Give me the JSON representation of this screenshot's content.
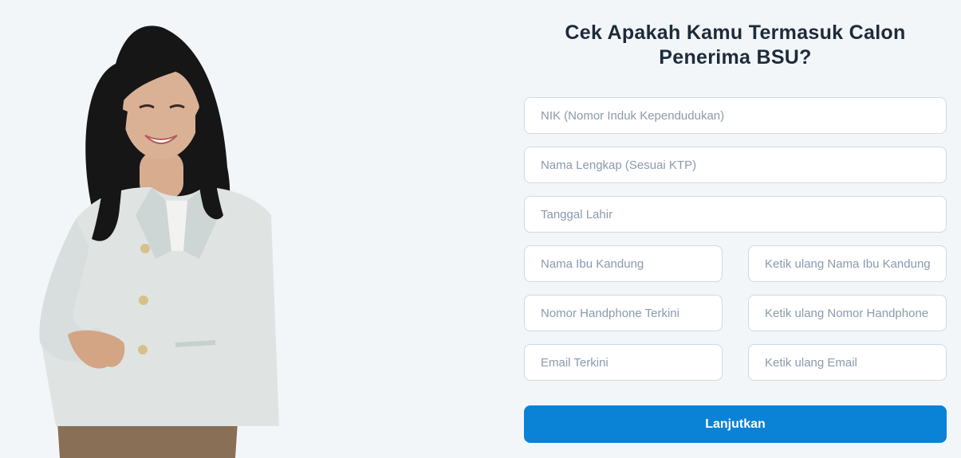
{
  "form": {
    "title_line1": "Cek Apakah Kamu Termasuk Calon",
    "title_line2": "Penerima BSU?",
    "fields": {
      "nik": {
        "placeholder": "NIK (Nomor Induk Kependudukan)",
        "value": ""
      },
      "full_name": {
        "placeholder": "Nama Lengkap (Sesuai KTP)",
        "value": ""
      },
      "birth_date": {
        "placeholder": "Tanggal Lahir",
        "value": ""
      },
      "mother_name": {
        "placeholder": "Nama Ibu Kandung",
        "value": ""
      },
      "mother_name_confirm": {
        "placeholder": "Ketik ulang Nama Ibu Kandung",
        "value": ""
      },
      "phone": {
        "placeholder": "Nomor Handphone Terkini",
        "value": ""
      },
      "phone_confirm": {
        "placeholder": "Ketik ulang Nomor Handphone",
        "value": ""
      },
      "email": {
        "placeholder": "Email Terkini",
        "value": ""
      },
      "email_confirm": {
        "placeholder": "Ketik ulang Email",
        "value": ""
      }
    },
    "submit_label": "Lanjutkan"
  },
  "colors": {
    "background": "#f3f6f9",
    "title": "#1d2b3a",
    "field_border": "#cfd9e2",
    "placeholder": "#8a9aab",
    "button": "#0a82d6",
    "button_text": "#ffffff"
  },
  "illustration": {
    "subject": "woman-in-light-blazer"
  }
}
